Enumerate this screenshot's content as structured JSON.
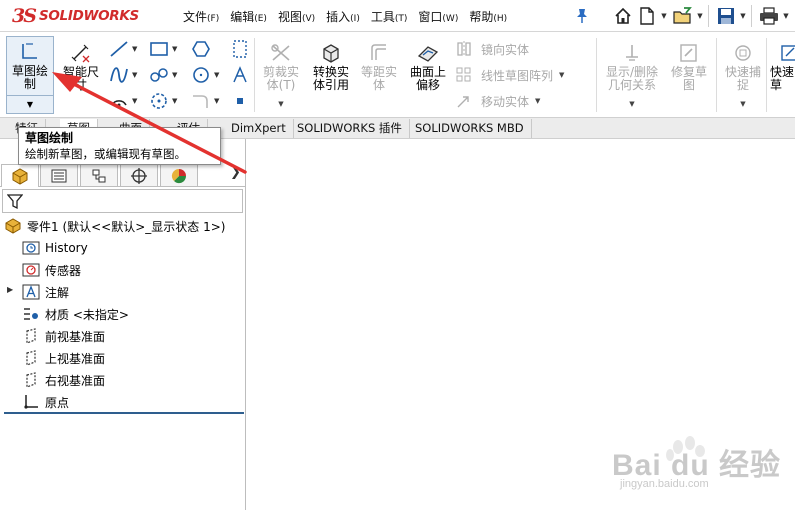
{
  "app": {
    "logo_mark": "3S",
    "logo_text": "SOLIDWORKS"
  },
  "menu": [
    {
      "label": "文件",
      "key": "(F)"
    },
    {
      "label": "编辑",
      "key": "(E)"
    },
    {
      "label": "视图",
      "key": "(V)"
    },
    {
      "label": "插入",
      "key": "(I)"
    },
    {
      "label": "工具",
      "key": "(T)"
    },
    {
      "label": "窗口",
      "key": "(W)"
    },
    {
      "label": "帮助",
      "key": "(H)"
    }
  ],
  "ribbon": {
    "sketch": {
      "line1": "草图绘",
      "line2": "制"
    },
    "smart_dim": {
      "line1": "智能尺",
      "line2": "寸"
    },
    "trim": {
      "line1": "剪裁实",
      "line2": "体(T)"
    },
    "convert": {
      "line1": "转换实",
      "line2": "体引用"
    },
    "offset": {
      "line1": "等距实",
      "line2": "体"
    },
    "surface_offset": {
      "line1": "曲面上",
      "line2": "偏移"
    },
    "mirror": "镜向实体",
    "linear_pattern": "线性草图阵列",
    "move": "移动实体",
    "show_delete": {
      "line1": "显示/删除",
      "line2": "几何关系"
    },
    "repair": {
      "line1": "修复草",
      "line2": "图"
    },
    "rapid_snap": {
      "line1": "快速捕",
      "line2": "捉"
    },
    "quick": {
      "line1": "快速",
      "line2": "草"
    }
  },
  "tabs": [
    "特征",
    "草图",
    "曲面",
    "评估",
    "DimXpert",
    "SOLIDWORKS 插件",
    "SOLIDWORKS MBD"
  ],
  "tooltip": {
    "title": "草图绘制",
    "body": "绘制新草图，或编辑现有草图。"
  },
  "tree": {
    "root": "零件1 (默认<<默认>_显示状态 1>)",
    "items": [
      "History",
      "传感器",
      "注解",
      "材质 <未指定>",
      "前视基准面",
      "上视基准面",
      "右视基准面",
      "原点"
    ]
  },
  "watermark": {
    "text": "Bai du 经验",
    "sub": "jingyan.baidu.com"
  },
  "colors": {
    "brand_red": "#d12b2b",
    "arrow_red": "#e3322f",
    "icon_blue": "#1f5fa8",
    "tree_accent": "#2e5e8e"
  }
}
